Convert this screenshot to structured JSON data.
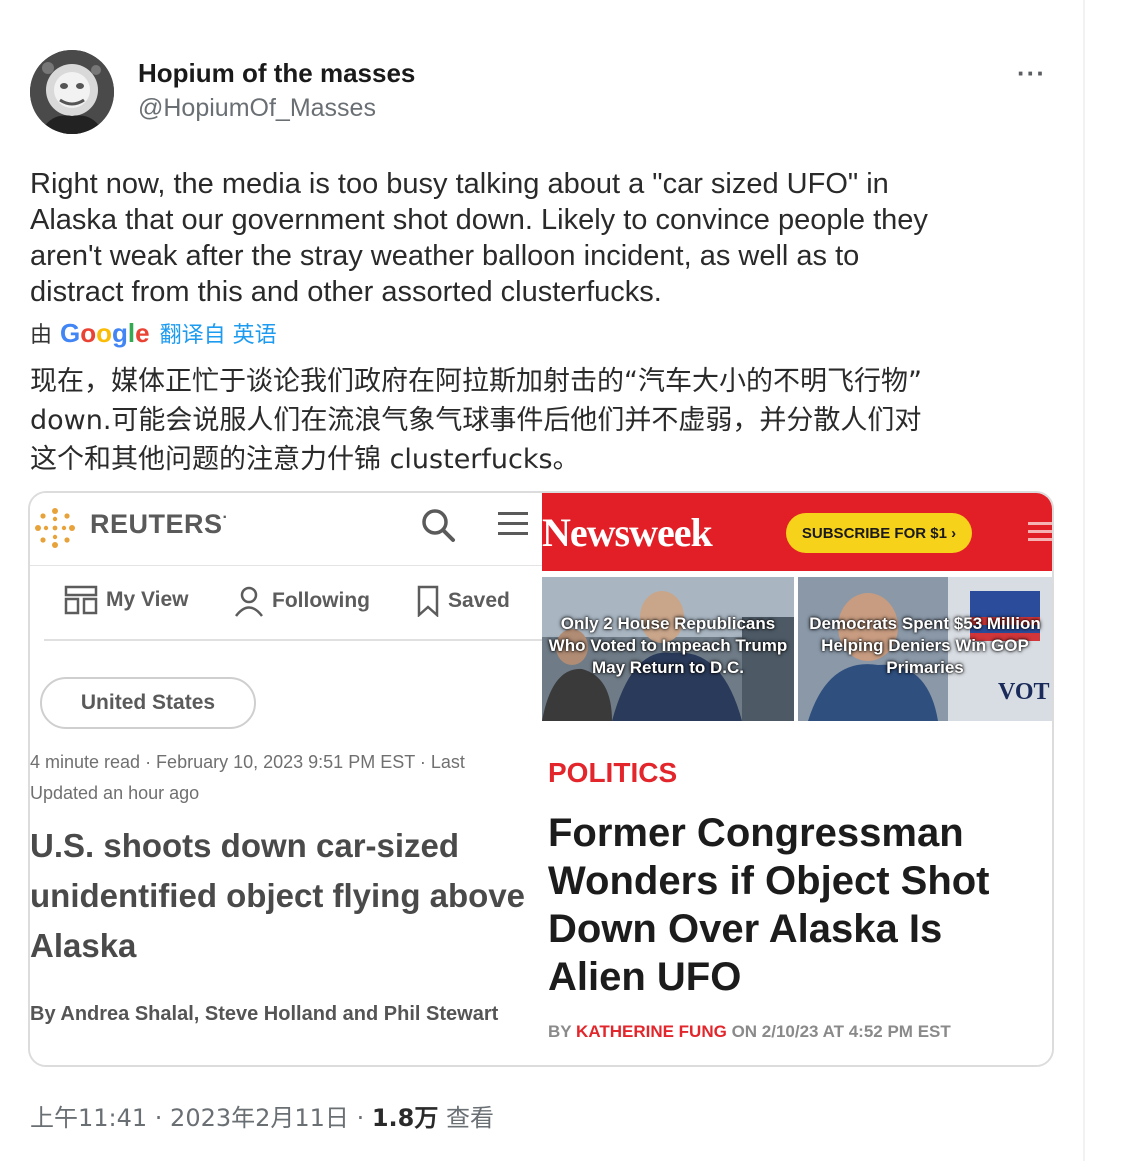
{
  "tweet": {
    "display_name": "Hopium of the masses",
    "handle": "@HopiumOf_Masses",
    "more_label": "···",
    "text": "Right now, the media is too busy talking about a \"car sized UFO\" in\nAlaska that our government shot down. Likely to convince people they\naren't weak after the stray weather balloon incident, as well as to\ndistract from this and other assorted clusterfucks.",
    "translate_by": "由",
    "google_logo": [
      "G",
      "o",
      "o",
      "g",
      "l",
      "e"
    ],
    "translate_link": "翻译自 英语",
    "translated_text": "现在，媒体正忙于谈论我们政府在阿拉斯加射击的“汽车大小的不明飞行物”\ndown.可能会说服人们在流浪气象气球事件后他们并不虚弱，并分散人们对\n这个和其他问题的注意力什锦 clusterfucks。",
    "time": "上午11:41 · 2023年2月11日 · ",
    "views_count": "1.8万",
    "views_label": " 查看"
  },
  "reuters": {
    "brand": "REUTERS",
    "brand_mark": "·",
    "nav": [
      {
        "label": "My View",
        "icon": "my-view-icon"
      },
      {
        "label": "Following",
        "icon": "person-icon"
      },
      {
        "label": "Saved",
        "icon": "bookmark-icon"
      }
    ],
    "chip": "United States",
    "meta": "4 minute read · February 10, 2023 9:51 PM EST · Last Updated an hour ago",
    "headline": "U.S. shoots down car-sized unidentified object flying above Alaska",
    "byline": "By Andrea Shalal, Steve Holland and Phil Stewart"
  },
  "newsweek": {
    "brand": "Newsweek",
    "subscribe": "SUBSCRIBE FOR $1 ›",
    "thumb1": "Only 2 House Republicans Who Voted to Impeach Trump May Return to D.C.",
    "thumb2": "Democrats Spent $53 Million Helping Deniers Win GOP Primaries",
    "thumb2_sign": "VOT",
    "section": "POLITICS",
    "headline": "Former Congressman Wonders if Object Shot Down Over Alaska Is Alien UFO",
    "byline_prefix": "BY ",
    "author": "KATHERINE FUNG",
    "byline_suffix": " ON 2/10/23 AT 4:52 PM EST"
  },
  "colors": {
    "newsweek_red": "#e21f26",
    "subscribe_yellow": "#f7d21a",
    "link_blue": "#1d9bf0",
    "politics_red": "#e2262b"
  }
}
